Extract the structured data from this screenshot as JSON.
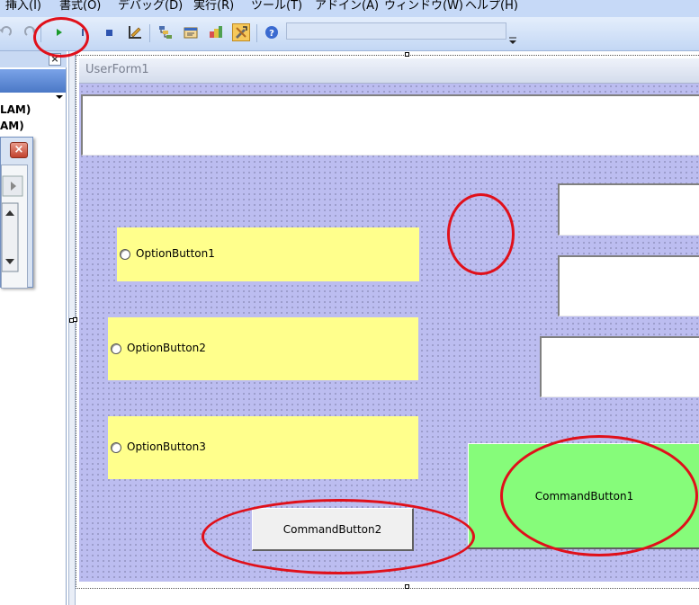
{
  "menu": {
    "items": [
      "挿入(I)",
      "書式(O)",
      "デバッグ(D)",
      "実行(R)",
      "ツール(T)",
      "アドイン(A)",
      "ウィンドウ(W)",
      "ヘルプ(H)"
    ]
  },
  "toolbar": {
    "icons": [
      "undo-icon",
      "redo-icon",
      "run-icon",
      "break-icon",
      "reset-icon",
      "design-mode-icon",
      "project-explorer-icon",
      "properties-icon",
      "object-browser-icon",
      "toolbox-icon",
      "help-icon"
    ]
  },
  "project_panel": {
    "close_label": "×",
    "lines": [
      "LAM)",
      "AM)"
    ]
  },
  "small_window": {
    "close_label": "×"
  },
  "form": {
    "title": "UserForm1",
    "option_buttons": [
      "OptionButton1",
      "OptionButton2",
      "OptionButton3"
    ],
    "command_button_1": "CommandButton1",
    "command_button_2": "CommandButton2"
  },
  "colors": {
    "form_background": "#bcbdf0",
    "option_background": "#ffff8c",
    "command_button_1_background": "#86fc7a",
    "command_button_2_background": "#f0f0f0",
    "annotation": "#e0101a"
  }
}
